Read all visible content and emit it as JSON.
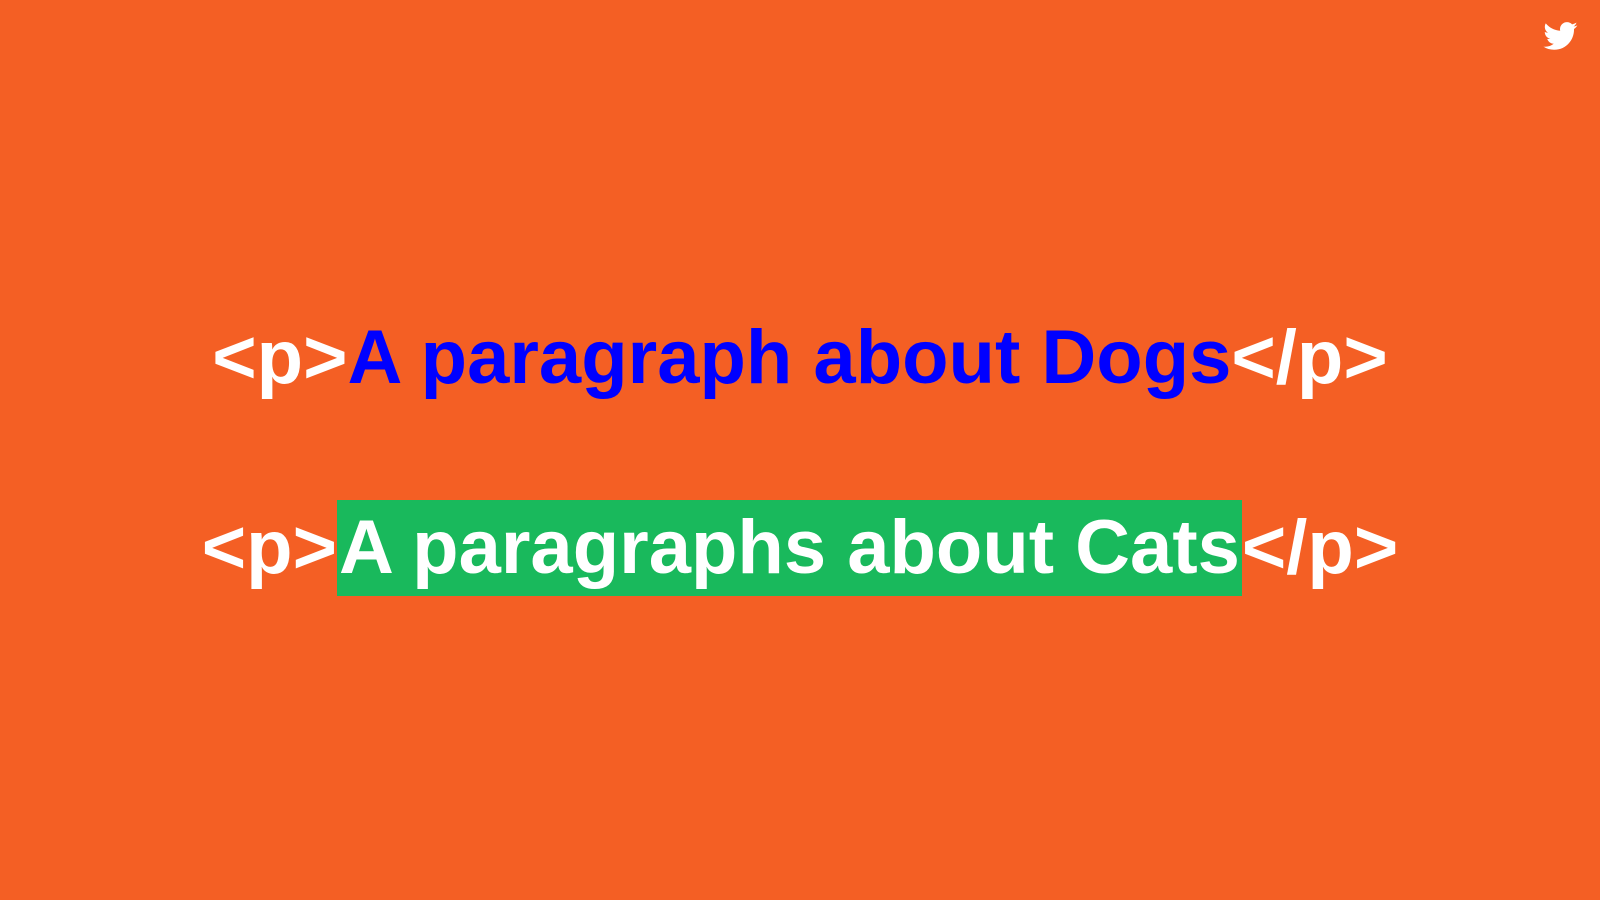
{
  "slide": {
    "background_color": "#f45f24",
    "icon": "twitter-bird-icon",
    "lines": [
      {
        "open_tag": "<p>",
        "text": "A paragraph about Dogs",
        "close_tag": "</p>",
        "text_color": "#0000ff"
      },
      {
        "open_tag": "<p>",
        "text": "A paragraphs about Cats",
        "close_tag": "</p>",
        "text_color": "#ffffff",
        "highlight_color": "#19b95c"
      }
    ]
  }
}
